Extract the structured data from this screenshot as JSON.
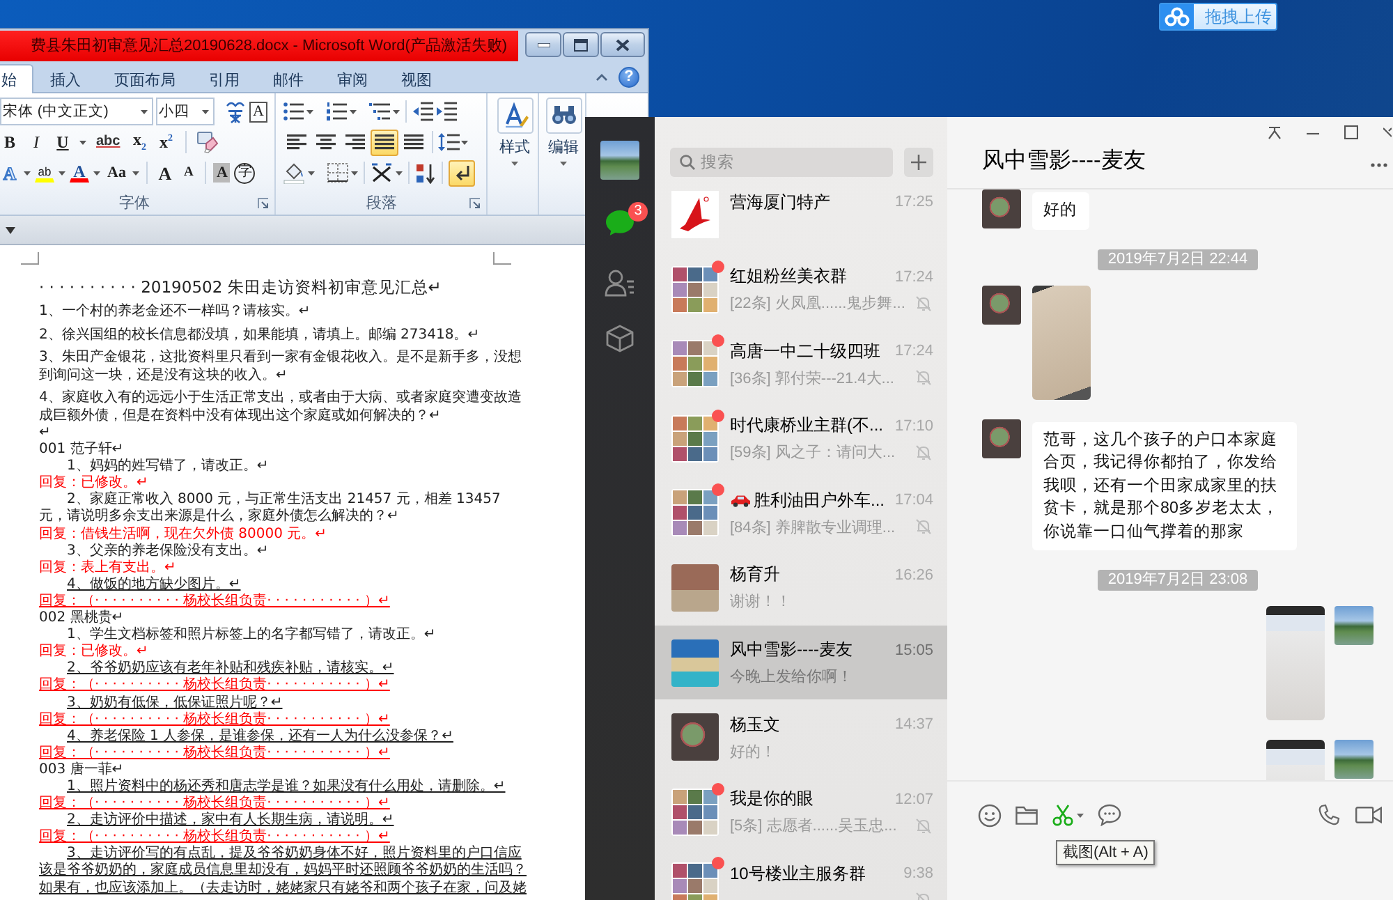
{
  "desktop": {
    "upload_button": "拖拽上传"
  },
  "word": {
    "title": "费县朱田初审意见汇总20190628.docx - Microsoft Word(产品激活失败)",
    "tabs": [
      {
        "label": "始",
        "selected": true
      },
      {
        "label": "插入",
        "selected": false
      },
      {
        "label": "页面布局",
        "selected": false
      },
      {
        "label": "引用",
        "selected": false
      },
      {
        "label": "邮件",
        "selected": false
      },
      {
        "label": "审阅",
        "selected": false
      },
      {
        "label": "视图",
        "selected": false
      }
    ],
    "help": "?",
    "font_group": {
      "label": "字体",
      "font_name": "宋体 (中文正文)",
      "font_size": "小四",
      "char_border": "A",
      "format_buttons": [
        {
          "kind": "bold",
          "label": "B",
          "dropdown": false
        },
        {
          "kind": "italic",
          "label": "I",
          "dropdown": false
        },
        {
          "kind": "underline",
          "label": "U",
          "dropdown": true
        },
        {
          "kind": "strike",
          "label": "abc",
          "dropdown": false
        },
        {
          "kind": "sub",
          "label": "x$_{2}$",
          "dropdown": false
        },
        {
          "kind": "sup",
          "label": "x$^{2}$",
          "dropdown": false
        }
      ],
      "effect_buttons": [
        {
          "kind": "effect",
          "label": "A",
          "dropdown": true
        },
        {
          "kind": "highlight",
          "label": "ab",
          "dropdown": true
        },
        {
          "kind": "color",
          "label": "A",
          "dropdown": true
        },
        {
          "kind": "case",
          "label": "Aa",
          "dropdown": true
        },
        {
          "kind": "grow",
          "label": "A",
          "dropdown": false
        },
        {
          "kind": "shrink",
          "label": "A",
          "dropdown": false
        },
        {
          "kind": "shade",
          "label": "A",
          "dropdown": false
        },
        {
          "kind": "enclose",
          "label": "字",
          "dropdown": false
        }
      ]
    },
    "paragraph_group": {
      "label": "段落",
      "alignment": [
        {
          "kind": "left",
          "selected": false
        },
        {
          "kind": "center",
          "selected": false
        },
        {
          "kind": "right",
          "selected": false
        },
        {
          "kind": "justify",
          "selected": true
        },
        {
          "kind": "distributed",
          "selected": false
        }
      ],
      "show_marks": true
    },
    "big_buttons": [
      {
        "kind": "styles",
        "label": "样式"
      },
      {
        "kind": "find",
        "label": "编辑"
      }
    ],
    "document": {
      "lines": [
        {
          "kind": "title",
          "text": "· · · · · · · · · · 20190502 朱田走访资料初审意见汇总↵",
          "underlined": false
        },
        {
          "kind": "item",
          "text": "1、一个村的养老金还不一样吗？请核实。↵",
          "underlined": false
        },
        {
          "kind": "item",
          "text": "2、徐兴国组的校长信息都没填，如果能填，请填上。邮编 273418。↵",
          "underlined": false
        },
        {
          "kind": "item",
          "text": "3、朱田产金银花，这批资料里只看到一家有金银花收入。是不是新手多，没想到询问这一块，还是没有这块的收入。↵",
          "underlined": false
        },
        {
          "kind": "item",
          "text": "4、家庭收入有的远远小于生活正常支出，或者由于大病、或者家庭突遭变故造成巨额外债，但是在资料中没有体现出这个家庭或如何解决的？↵",
          "underlined": false
        },
        {
          "kind": "blank",
          "text": "↵",
          "underlined": false
        },
        {
          "kind": "heading",
          "text": "001 范子轩↵",
          "underlined": false
        },
        {
          "kind": "question",
          "text": "1、妈妈的姓写错了，请改正。↵",
          "underlined": false
        },
        {
          "kind": "reply",
          "text": "回复：已修改。↵",
          "underlined": false
        },
        {
          "kind": "question",
          "text": "2、家庭正常收入 8000 元，与正常生活支出 21457 元，相差 13457 元，请说明多余支出来源是什么，家庭外债怎么解决的？↵",
          "underlined": false
        },
        {
          "kind": "reply",
          "text": "回复：借钱生活啊，现在欠外债 80000 元。↵",
          "underlined": false
        },
        {
          "kind": "question",
          "text": "3、父亲的养老保险没有支出。↵",
          "underlined": false
        },
        {
          "kind": "reply",
          "text": "回复：表上有支出。↵",
          "underlined": false
        },
        {
          "kind": "question",
          "text": "4、做饭的地方缺少图片。↵",
          "underlined": true
        },
        {
          "kind": "reply",
          "text": "回复：（· · · · · · · · · · 杨校长组负责· · · · · · · · · · · ）↵",
          "underlined": true
        },
        {
          "kind": "heading",
          "text": "002 黑桃贵↵",
          "underlined": false
        },
        {
          "kind": "question",
          "text": "1、学生文档标签和照片标签上的名字都写错了，请改正。↵",
          "underlined": false
        },
        {
          "kind": "reply",
          "text": "回复：已修改。↵",
          "underlined": false
        },
        {
          "kind": "question",
          "text": "2、爷爷奶奶应该有老年补贴和残疾补贴，请核实。↵",
          "underlined": true
        },
        {
          "kind": "reply",
          "text": "回复：（· · · · · · · · · · 杨校长组负责· · · · · · · · · · · ）↵",
          "underlined": true
        },
        {
          "kind": "question",
          "text": "3、奶奶有低保，低保证照片呢？↵",
          "underlined": true
        },
        {
          "kind": "reply",
          "text": "回复：（· · · · · · · · · · 杨校长组负责· · · · · · · · · · · ）↵",
          "underlined": true
        },
        {
          "kind": "question",
          "text": "4、养老保险 1 人参保，是谁参保，还有一人为什么没参保？↵",
          "underlined": true
        },
        {
          "kind": "reply",
          "text": "回复：（· · · · · · · · · · 杨校长组负责· · · · · · · · · · · ）↵",
          "underlined": true
        },
        {
          "kind": "heading",
          "text": "003 唐一菲↵",
          "underlined": false
        },
        {
          "kind": "question",
          "text": "1、照片资料中的杨还秀和唐志学是谁？如果没有什么用处，请删除。↵",
          "underlined": true
        },
        {
          "kind": "reply",
          "text": "回复：（· · · · · · · · · · 杨校长组负责· · · · · · · · · · · ）↵",
          "underlined": true
        },
        {
          "kind": "question",
          "text": "2、走访评价中描述，家中有人长期生病，请说明。↵",
          "underlined": true
        },
        {
          "kind": "reply",
          "text": "回复：（· · · · · · · · · · 杨校长组负责· · · · · · · · · · · ）↵",
          "underlined": true
        },
        {
          "kind": "question",
          "text": "3、走访评价写的有点乱，提及爷爷奶奶身体不好，照片资料里的户口信应该是爷爷奶奶的，家庭成员信息里却没有，妈妈平时还照顾爷爷奶奶的生活吗？如果有，也应该添加上。（去走访时，姥姥家只有姥爷和两个孩子在家，问及姥",
          "underlined": true
        }
      ]
    }
  },
  "wechat": {
    "sidebar": {
      "unread_badge": "3"
    },
    "search": {
      "placeholder": "搜索"
    },
    "chats": [
      {
        "kind": "logo",
        "name": "营海厦门特产",
        "time": "17:25",
        "car": false,
        "unread": false,
        "muted": false,
        "selected": false
      },
      {
        "kind": "group",
        "name": "红姐粉丝美衣群",
        "preview": "[22条] 火凤凰......鬼步舞...",
        "time": "17:24",
        "car": false,
        "unread": true,
        "muted": true,
        "selected": false
      },
      {
        "kind": "group",
        "name": "高唐一中二十级四班",
        "preview": "[36条] 郭付荣---21.4大...",
        "time": "17:24",
        "car": false,
        "unread": true,
        "muted": true,
        "selected": false
      },
      {
        "kind": "group",
        "name": "时代康桥业主群(不...",
        "preview": "[59条] 风之子：请问大...",
        "time": "17:10",
        "car": false,
        "unread": true,
        "muted": true,
        "selected": false
      },
      {
        "kind": "group",
        "name": "胜利油田户外车...",
        "preview": "[84条] 养脾散专业调理...",
        "time": "17:04",
        "car": true,
        "unread": true,
        "muted": true,
        "selected": false
      },
      {
        "kind": "photo",
        "name": "杨育升",
        "preview": "谢谢！！",
        "time": "16:26",
        "car": false,
        "unread": false,
        "muted": false,
        "selected": false
      },
      {
        "kind": "photo",
        "name": "风中雪影----麦友",
        "preview": "今晚上发给你啊！",
        "time": "15:05",
        "car": false,
        "unread": false,
        "muted": false,
        "selected": true
      },
      {
        "kind": "photo",
        "name": "杨玉文",
        "preview": "好的！",
        "time": "14:37",
        "car": false,
        "unread": false,
        "muted": false,
        "selected": false
      },
      {
        "kind": "group",
        "name": "我是你的眼",
        "preview": "[5条] 志愿者......吴玉忠...",
        "time": "12:07",
        "car": false,
        "unread": true,
        "muted": true,
        "selected": false
      },
      {
        "kind": "group",
        "name": "10号楼业主服务群",
        "time": "9:38",
        "car": false,
        "unread": true,
        "muted": true,
        "selected": false
      }
    ],
    "chat": {
      "title": "风中雪影----麦友",
      "messages": [
        {
          "kind": "text",
          "outgoing": false,
          "text": "好的"
        },
        {
          "kind": "time",
          "text": "2019年7月2日 22:44"
        },
        {
          "kind": "image",
          "outgoing": false
        },
        {
          "kind": "text",
          "outgoing": false,
          "text": "范哥，这几个孩子的户口本家庭合页，我记得你都拍了，你发给我呗，还有一个田家成家里的扶贫卡，就是那个80多岁老太太，你说靠一口仙气撑着的那家"
        },
        {
          "kind": "time",
          "text": "2019年7月2日 23:08"
        },
        {
          "kind": "image",
          "outgoing": true
        },
        {
          "kind": "image",
          "outgoing": true
        }
      ]
    },
    "tooltip": "截图(Alt + A)"
  }
}
